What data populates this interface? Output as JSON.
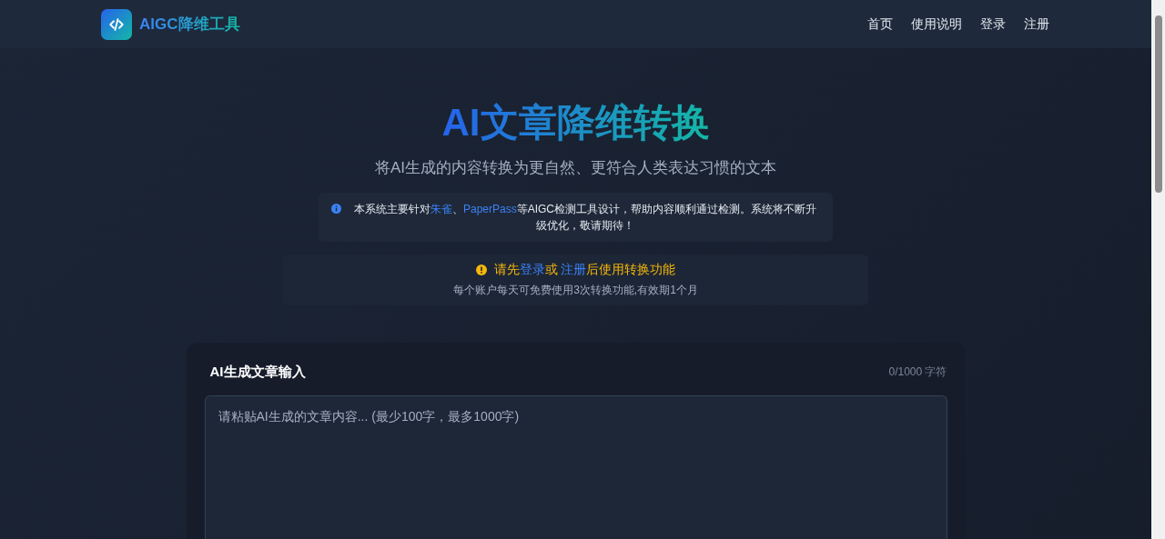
{
  "header": {
    "logo_text": "AIGC降维工具",
    "nav": [
      {
        "label": "首页"
      },
      {
        "label": "使用说明"
      },
      {
        "label": "登录"
      },
      {
        "label": "注册"
      }
    ]
  },
  "hero": {
    "title": "AI文章降维转换",
    "subtitle": "将AI生成的内容转换为更自然、更符合人类表达习惯的文本"
  },
  "notice": {
    "segments": [
      {
        "kind": "text",
        "text": "本系统主要针对"
      },
      {
        "kind": "link",
        "text": "朱雀"
      },
      {
        "kind": "text",
        "text": "、"
      },
      {
        "kind": "link",
        "text": "PaperPass"
      },
      {
        "kind": "text",
        "text": "等AIGC检测工具设计，帮助内容顺利通过检测。系统将不断升级优化，敬请期待！"
      }
    ]
  },
  "login_prompt": {
    "segments": [
      {
        "kind": "text",
        "text": "请先"
      },
      {
        "kind": "link",
        "text": "登录"
      },
      {
        "kind": "text",
        "text": "或 "
      },
      {
        "kind": "link",
        "text": "注册"
      },
      {
        "kind": "text",
        "text": "后使用转换功能"
      }
    ],
    "note": "每个账户每天可免费使用3次转换功能,有效期1个月"
  },
  "input_card": {
    "title": "AI生成文章输入",
    "counter": "0/1000 字符",
    "placeholder": "请粘贴AI生成的文章内容... (最少100字，最多1000字)"
  }
}
